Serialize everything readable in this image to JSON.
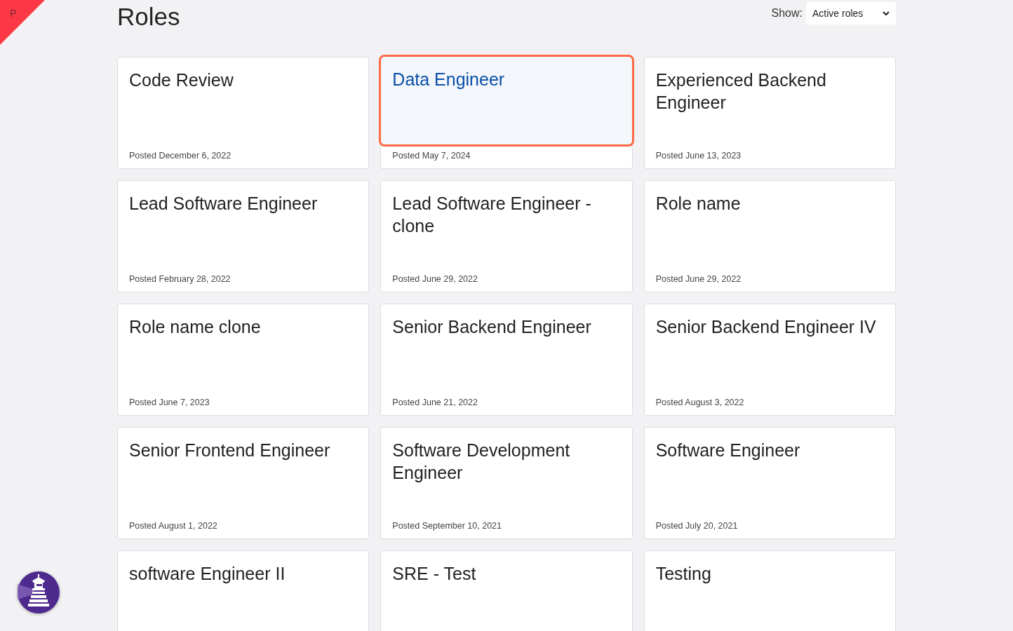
{
  "corner_badge": {
    "label": "P"
  },
  "header": {
    "title": "Roles",
    "filter_label": "Show:",
    "filter_value": "Active roles"
  },
  "roles": [
    {
      "title": "Code Review",
      "posted": "Posted December 6, 2022",
      "selected": false
    },
    {
      "title": "Data Engineer",
      "posted": "Posted May 7, 2024",
      "selected": true
    },
    {
      "title": "Experienced Backend Engineer",
      "posted": "Posted June 13, 2023",
      "selected": false
    },
    {
      "title": "Lead Software Engineer",
      "posted": "Posted February 28, 2022",
      "selected": false
    },
    {
      "title": "Lead Software Engineer - clone",
      "posted": "Posted June 29, 2022",
      "selected": false
    },
    {
      "title": "Role name",
      "posted": "Posted June 29, 2022",
      "selected": false
    },
    {
      "title": "Role name clone",
      "posted": "Posted June 7, 2023",
      "selected": false
    },
    {
      "title": "Senior Backend Engineer",
      "posted": "Posted June 21, 2022",
      "selected": false
    },
    {
      "title": "Senior Backend Engineer IV",
      "posted": "Posted August 3, 2022",
      "selected": false
    },
    {
      "title": "Senior Frontend Engineer",
      "posted": "Posted August 1, 2022",
      "selected": false
    },
    {
      "title": "Software Development Engineer",
      "posted": "Posted September 10, 2021",
      "selected": false
    },
    {
      "title": "Software Engineer",
      "posted": "Posted July 20, 2021",
      "selected": false
    },
    {
      "title": "software Engineer II",
      "selected": false
    },
    {
      "title": "SRE - Test",
      "selected": false
    },
    {
      "title": "Testing",
      "selected": false
    }
  ]
}
